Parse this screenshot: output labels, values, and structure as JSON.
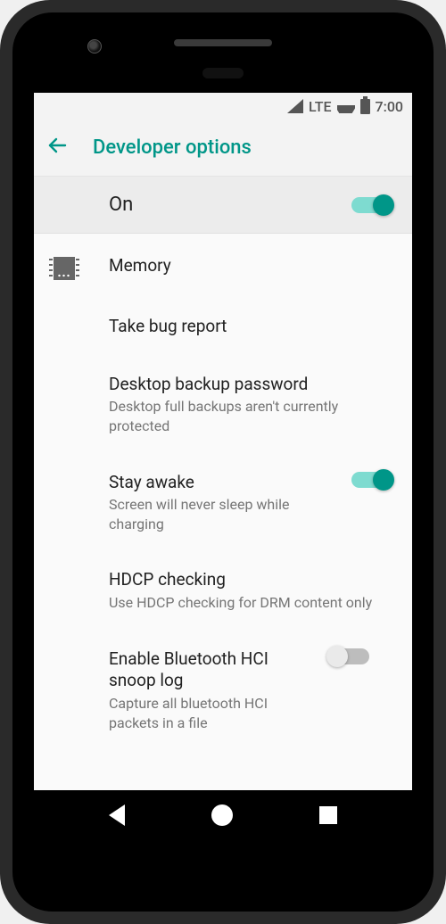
{
  "status": {
    "net": "LTE",
    "time": "7:00"
  },
  "header": {
    "title": "Developer options"
  },
  "master": {
    "label": "On",
    "enabled": true
  },
  "items": [
    {
      "title": "Memory",
      "sub": null,
      "icon": "chip",
      "toggle": null
    },
    {
      "title": "Take bug report",
      "sub": null,
      "icon": null,
      "toggle": null
    },
    {
      "title": "Desktop backup password",
      "sub": "Desktop full backups aren't currently protected",
      "icon": null,
      "toggle": null
    },
    {
      "title": "Stay awake",
      "sub": "Screen will never sleep while charging",
      "icon": null,
      "toggle": true
    },
    {
      "title": "HDCP checking",
      "sub": "Use HDCP checking for DRM content only",
      "icon": null,
      "toggle": null
    },
    {
      "title": "Enable Bluetooth HCI snoop log",
      "sub": "Capture all bluetooth HCI packets in a file",
      "icon": null,
      "toggle": false
    }
  ]
}
